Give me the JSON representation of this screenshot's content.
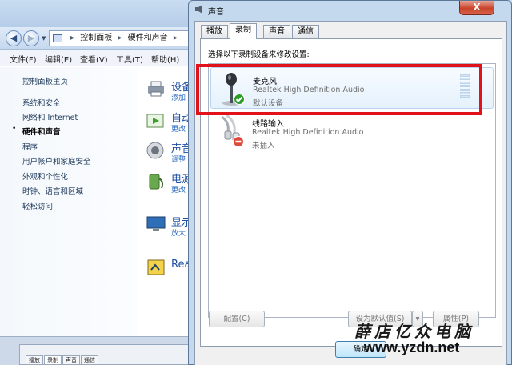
{
  "control_panel": {
    "breadcrumb": [
      "控制面板",
      "硬件和声音"
    ],
    "menu": [
      "文件(F)",
      "编辑(E)",
      "查看(V)",
      "工具(T)",
      "帮助(H)"
    ],
    "sidebar": {
      "home": "控制面板主页",
      "items": [
        "系统和安全",
        "网络和 Internet",
        "硬件和声音",
        "程序",
        "用户帐户和家庭安全",
        "外观和个性化",
        "时钟、语言和区域",
        "轻松访问"
      ]
    },
    "categories": [
      {
        "title": "设备",
        "sub": "添加",
        "icon": "devices-printers-icon"
      },
      {
        "title": "自动",
        "sub": "更改",
        "icon": "autoplay-icon"
      },
      {
        "title": "声音",
        "sub": "调整",
        "icon": "sound-speaker-icon"
      },
      {
        "title": "电源",
        "sub": "更改",
        "icon": "power-options-icon"
      },
      {
        "title": "显示",
        "sub": "放大",
        "icon": "display-monitor-icon"
      },
      {
        "title": "Rea",
        "sub": "",
        "icon": "realtek-manager-icon"
      }
    ],
    "mini_tabs": [
      "播放",
      "录制",
      "声音",
      "通信"
    ]
  },
  "dialog": {
    "title": "声音",
    "close_label": "X",
    "tabs": [
      "播放",
      "录制",
      "声音",
      "通信"
    ],
    "active_tab": "录制",
    "instruction": "选择以下录制设备来修改设置:",
    "devices": [
      {
        "name": "麦克风",
        "driver": "Realtek High Definition Audio",
        "status": "默认设备",
        "icon": "microphone-icon",
        "badge": "default-check-icon"
      },
      {
        "name": "线路输入",
        "driver": "Realtek High Definition Audio",
        "status": "未插入",
        "icon": "line-in-cable-icon",
        "badge": "unplugged-icon"
      }
    ],
    "buttons": {
      "configure": "配置(C)",
      "set_default": "设为默认值(S)",
      "properties": "属性(P)",
      "ok": "确定"
    }
  },
  "watermark": {
    "text": "薛店亿众电脑",
    "url": "www.yzdn.net"
  },
  "colors": {
    "highlight_box": "#e2121b",
    "link_blue": "#1e4fa0",
    "dialog_frame": "#c4d8ee"
  }
}
